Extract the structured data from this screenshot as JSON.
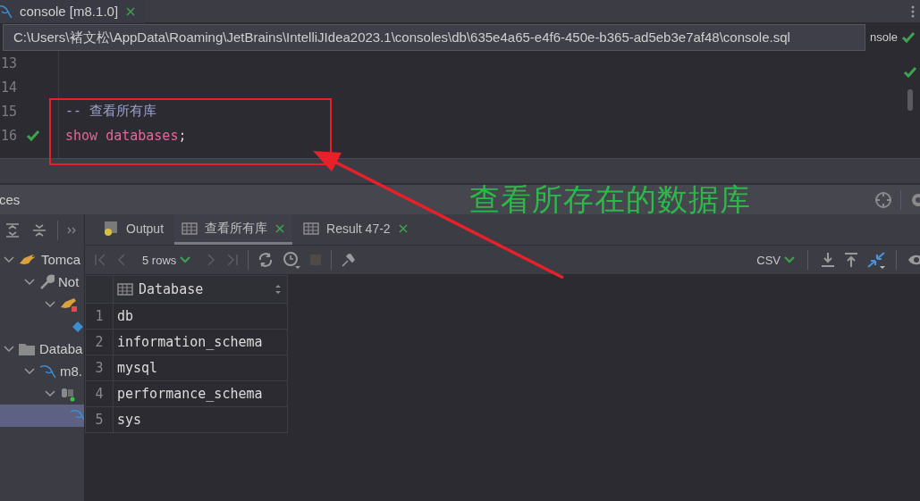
{
  "editor_tab": {
    "title": "console [m8.1.0]",
    "closable": true
  },
  "tooltip": {
    "text": "C:\\Users\\褚文松\\AppData\\Roaming\\JetBrains\\IntelliJIdea2023.1\\consoles\\db\\635e4a65-e4f6-450e-b365-ad5eb3e7af48\\console.sql"
  },
  "editor": {
    "toolbar_text": "nsole",
    "lines": [
      {
        "number": "13",
        "ok": false
      },
      {
        "number": "14",
        "ok": false
      },
      {
        "number": "15",
        "ok": false,
        "tokens": [
          {
            "kind": "comment",
            "text": "-- 查看所有库"
          }
        ]
      },
      {
        "number": "16",
        "ok": true,
        "tokens": [
          {
            "kind": "keyword",
            "text": "show databases"
          },
          {
            "kind": "punct",
            "text": ";"
          }
        ]
      }
    ]
  },
  "services": {
    "title": "ces"
  },
  "tree": [
    {
      "label": "Tomca",
      "selected": false,
      "children": [
        {
          "label": "Not",
          "selected": false,
          "children": [
            {
              "selected": false,
              "children": [
                {
                  "selected": false
                }
              ]
            }
          ]
        }
      ]
    },
    {
      "label": "Databa",
      "selected": false,
      "children": [
        {
          "label": "m8.",
          "selected": false,
          "children": [
            {
              "selected": false,
              "children": [
                {
                  "selected": true
                }
              ]
            }
          ]
        }
      ]
    }
  ],
  "result_tabs": [
    {
      "label": "Output",
      "selected": false,
      "closable": false
    },
    {
      "label": "查看所有库",
      "selected": true,
      "closable": true
    },
    {
      "label": "Result 47-2",
      "selected": false,
      "closable": true
    }
  ],
  "result_toolbar": {
    "rows": "5 rows",
    "format": "CSV"
  },
  "table": {
    "columns": [
      "Database"
    ],
    "rows": [
      {
        "number": "1",
        "cells": [
          "db"
        ]
      },
      {
        "number": "2",
        "cells": [
          "information_schema"
        ]
      },
      {
        "number": "3",
        "cells": [
          "mysql"
        ]
      },
      {
        "number": "4",
        "cells": [
          "performance_schema"
        ]
      },
      {
        "number": "5",
        "cells": [
          "sys"
        ]
      }
    ]
  },
  "annotation": {
    "caption": "查看所存在的数据库"
  }
}
